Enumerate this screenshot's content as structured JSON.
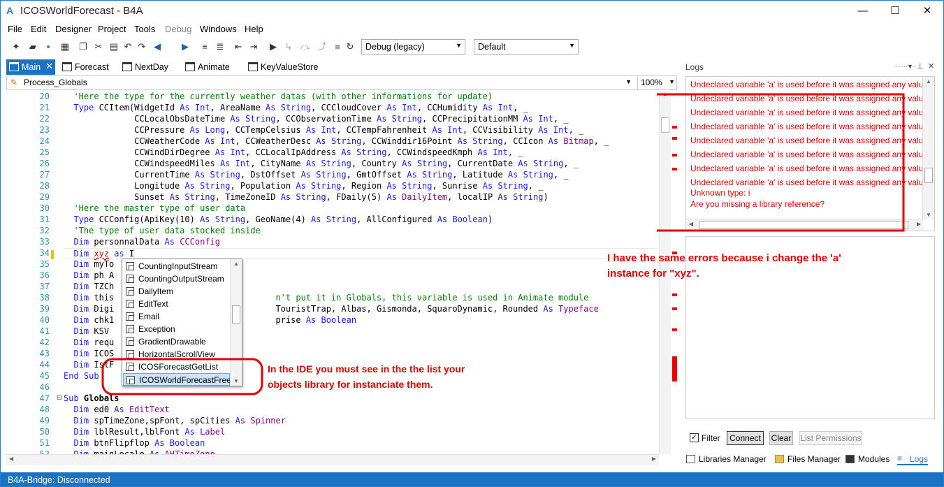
{
  "window": {
    "app_icon": "A",
    "title": "ICOSWorldForecast - B4A",
    "minimize": "—",
    "maximize": "☐",
    "close": "✕"
  },
  "menu": [
    "File",
    "Edit",
    "Designer",
    "Project",
    "Tools",
    "Debug",
    "Windows",
    "Help"
  ],
  "toolbar": {
    "build_config": "Debug (legacy)",
    "device": "Default"
  },
  "tabs": [
    "Main",
    "Forecast",
    "NextDay",
    "Animate",
    "KeyValueStore"
  ],
  "module_bar": {
    "procedure": "Process_Globals",
    "zoom": "100%"
  },
  "editor": {
    "line_numbers": [
      "20",
      "21",
      "22",
      "23",
      "24",
      "25",
      "26",
      "27",
      "28",
      "29",
      "30",
      "31",
      "32",
      "33",
      "34",
      "35",
      "36",
      "37",
      "38",
      "39",
      "40",
      "41",
      "42",
      "43",
      "44",
      "45",
      "46",
      "47",
      "48",
      "49",
      "50",
      "51",
      "52"
    ]
  },
  "autocomplete": {
    "items": [
      "CountingInputStream",
      "CountingOutputStream",
      "DailyItem",
      "EditText",
      "Email",
      "Exception",
      "GradientDrawable",
      "HorizontalScrollView",
      "ICOSForecastGetList",
      "ICOSWorldForecastFree"
    ],
    "selected": "ICOSWorldForecastFree"
  },
  "logs": {
    "title": "Logs",
    "lines": [
      "Undeclared variable 'a' is used before it was assigned any value.",
      "Undeclared variable 'a' is used before it was assigned any value.",
      "Undeclared variable 'a' is used before it was assigned any value.",
      "Undeclared variable 'a' is used before it was assigned any value.",
      "Undeclared variable 'a' is used before it was assigned any value.",
      "Undeclared variable 'a' is used before it was assigned any value.",
      "Undeclared variable 'a' is used before it was assigned any value.",
      "Undeclared variable 'a' is used before it was assigned any value.",
      "Unknown type: i",
      "Are you missing a library reference?"
    ],
    "filter_label": "Filter",
    "connect": "Connect",
    "clear": "Clear",
    "list_permissions": "List Permissions"
  },
  "bottom_tabs": [
    "Libraries Manager",
    "Files Manager",
    "Modules",
    "Logs"
  ],
  "status": "B4A-Bridge: Disconnected",
  "annotations": {
    "right": [
      "I have the same errors because i change the 'a'",
      "instance for \"xyz\"."
    ],
    "ide": [
      "In the IDE you must see in the the list your",
      "objects library for instanciate them."
    ]
  },
  "colors": {
    "accent": "#1c72c4",
    "error": "#e00000",
    "keyword": "#1a1aff",
    "comment": "#008000"
  }
}
